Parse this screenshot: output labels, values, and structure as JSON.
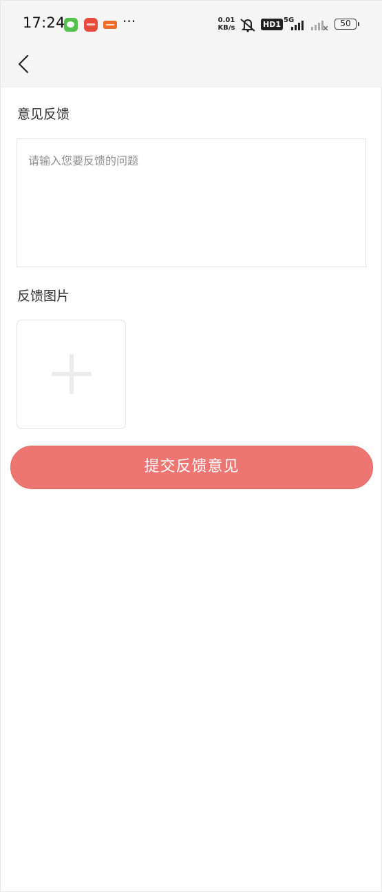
{
  "status_bar": {
    "time": "17:24",
    "more": "···",
    "net_speed_value": "0.01",
    "net_speed_unit": "KB/s",
    "hd_label": "HD1",
    "network_label": "5G",
    "battery": "50",
    "icons": [
      "wechat-icon",
      "app-notification-icon",
      "toutiao-icon",
      "mute-icon",
      "signal-icon"
    ]
  },
  "header": {
    "back_icon": "chevron-left-icon"
  },
  "form": {
    "feedback_label": "意见反馈",
    "feedback_placeholder": "请输入您要反馈的问题",
    "feedback_value": "",
    "images_label": "反馈图片",
    "add_image_icon": "plus-icon",
    "submit_label": "提交反馈意见"
  },
  "colors": {
    "accent": "#ee7672",
    "header_bg": "#f5f5f5",
    "text": "#333333",
    "placeholder": "#8e8e8e"
  }
}
